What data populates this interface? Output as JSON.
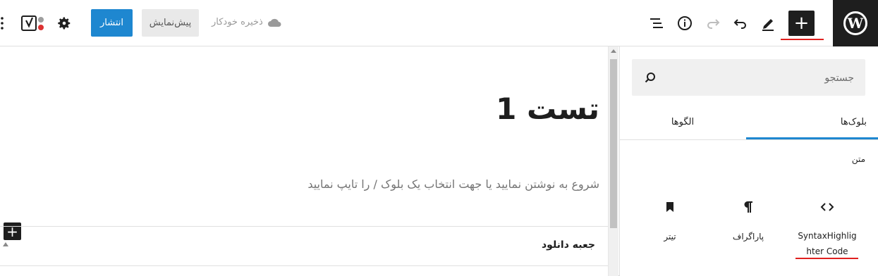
{
  "toolbar": {
    "inserter_label": "+",
    "autosave_label": "ذخیره خودکار",
    "preview_label": "پیش‌نمایش",
    "publish_label": "انتشار",
    "icons": [
      "wordpress-icon",
      "plus-icon",
      "pencil-icon",
      "undo-icon",
      "redo-icon",
      "info-icon",
      "list-view-icon",
      "cloud-icon",
      "gear-icon",
      "yoast-icon",
      "more-icon"
    ]
  },
  "editor": {
    "title": "تست 1",
    "placeholder": "شروع به نوشتن نمایید یا جهت انتخاب یک بلوک / را تایپ نمایید",
    "add_block_label": "+",
    "meta_box_title": "جعبه دانلود"
  },
  "inserter": {
    "search_placeholder": "جستجو",
    "tabs": [
      {
        "label": "بلوک‌ها",
        "active": true
      },
      {
        "label": "الگوها",
        "active": false
      }
    ],
    "category_title": "متن",
    "blocks": [
      {
        "label_line1": "SyntaxHighlig",
        "label_line2": "hter Code",
        "icon": "code-icon"
      },
      {
        "label": "پاراگراف",
        "icon": "paragraph-icon"
      },
      {
        "label": "تیتر",
        "icon": "bookmark-icon"
      }
    ]
  },
  "colors": {
    "accent": "#1e87d0",
    "dark": "#1e1e1e",
    "highlight_underline": "#e0201f"
  }
}
